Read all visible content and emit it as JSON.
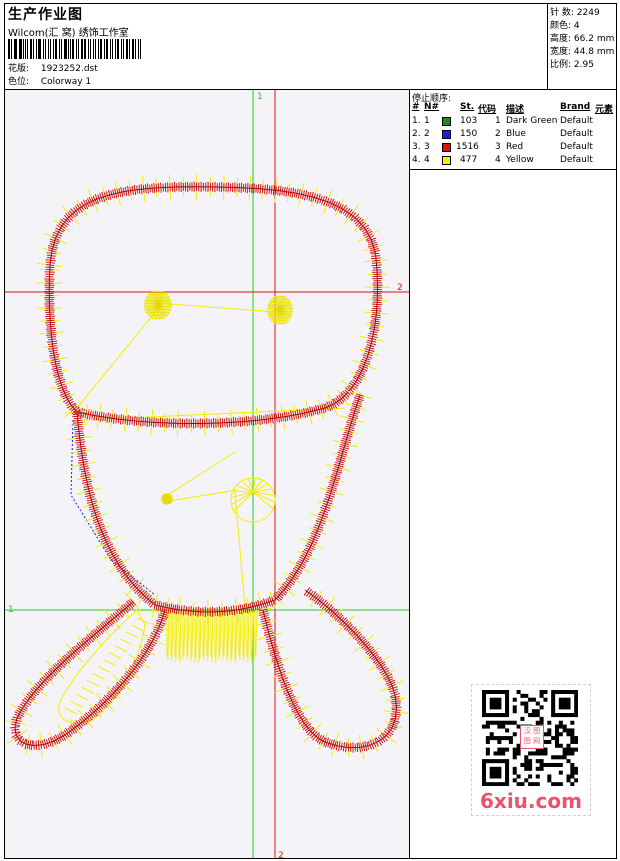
{
  "header": {
    "title": "生产作业图",
    "studio": "Wilcom(汇 窝) 绣饰工作室",
    "pattern_label": "花版:",
    "pattern_value": "1923252.dst",
    "colorway_label": "色位:",
    "colorway_value": "Colorway 1"
  },
  "stats": [
    {
      "label": "针 数:",
      "value": "2249"
    },
    {
      "label": "颜色:",
      "value": "4"
    },
    {
      "label": "高度:",
      "value": "66.2 mm"
    },
    {
      "label": "宽度:",
      "value": "44.8 mm"
    },
    {
      "label": "比例:",
      "value": "2.95"
    }
  ],
  "legend": {
    "title": "停止顺序:",
    "headers": [
      "#",
      "N#",
      "St.",
      "代码",
      "描述",
      "Brand",
      "元素"
    ],
    "rows": [
      {
        "num": "1.",
        "n": "1",
        "st": "103",
        "code": "1",
        "desc": "Dark Green",
        "brand": "Default",
        "color": "#1a8a1a"
      },
      {
        "num": "2.",
        "n": "2",
        "st": "150",
        "code": "2",
        "desc": "Blue",
        "brand": "Default",
        "color": "#1a1adc"
      },
      {
        "num": "3.",
        "n": "3",
        "st": "1516",
        "code": "3",
        "desc": "Red",
        "brand": "Default",
        "color": "#e01010"
      },
      {
        "num": "4.",
        "n": "4",
        "st": "477",
        "code": "4",
        "desc": "Yellow",
        "brand": "Default",
        "color": "#f4f000"
      }
    ]
  },
  "axes": {
    "v_green": "1",
    "h_red": "2",
    "h_green": "1",
    "v_red": "2"
  },
  "colors": {
    "guide_green": "#22cc22",
    "guide_red": "#e01010",
    "stitch_red": "#d21414",
    "stitch_yellow": "#f2ee00",
    "stitch_blue": "#2222dd",
    "watermark": "#e9546b"
  },
  "watermark": {
    "text": "6xiu.com",
    "qr_center": "汉 图 图 网"
  }
}
